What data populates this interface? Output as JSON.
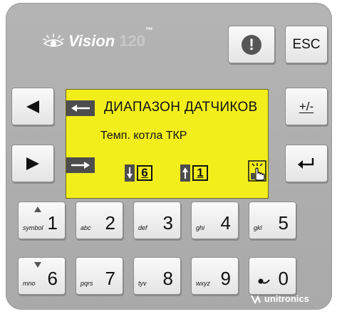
{
  "brand": {
    "name": "Vision",
    "model": "120",
    "tm": "™"
  },
  "keys": {
    "info_label": "!",
    "esc_label": "ESC",
    "plusminus_label": "+/-"
  },
  "screen": {
    "title": "ДИАПАЗОН ДАТЧИКОВ",
    "subtitle": "Темп. котла ТКР",
    "down_value": "6",
    "up_value": "1"
  },
  "keypad": [
    {
      "digit": "1",
      "letters": "symbol"
    },
    {
      "digit": "2",
      "letters": "abc"
    },
    {
      "digit": "3",
      "letters": "def"
    },
    {
      "digit": "4",
      "letters": "ghi"
    },
    {
      "digit": "5",
      "letters": "gkl"
    },
    {
      "digit": "6",
      "letters": "mno"
    },
    {
      "digit": "7",
      "letters": "pqrs"
    },
    {
      "digit": "8",
      "letters": "tyv"
    },
    {
      "digit": "9",
      "letters": "wxyz"
    },
    {
      "digit": "0",
      "letters": ""
    }
  ],
  "footer": {
    "logo": "unitronics"
  },
  "colors": {
    "lcd": "#f2ee1c",
    "panel": "#b0b0b0",
    "key": "#f2f2f2"
  }
}
